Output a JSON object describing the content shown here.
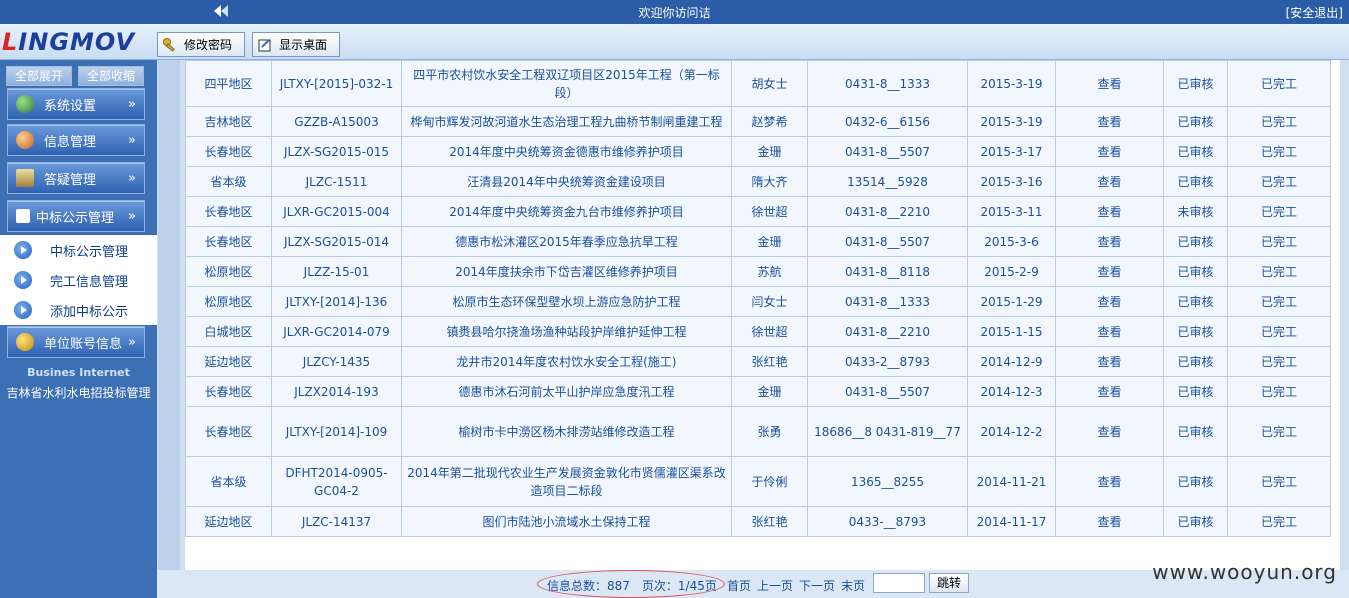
{
  "topbar": {
    "welcome": "欢迎你访问诘",
    "logout": "[安全退出]"
  },
  "logo": {
    "part1": "L",
    "part2": "INGMOV"
  },
  "header": {
    "change_password": "修改密码",
    "show_desktop": "显示桌面"
  },
  "sidebar": {
    "expand_all": "全部展开",
    "collapse_all": "全部收缩",
    "menus": [
      {
        "label": "系统设置",
        "chevron": "»"
      },
      {
        "label": "信息管理",
        "chevron": "»"
      },
      {
        "label": "答疑管理",
        "chevron": "»"
      },
      {
        "label": "中标公示管理",
        "chevron": "»"
      },
      {
        "label": "单位账号信息",
        "chevron": "»"
      }
    ],
    "subitems": [
      "中标公示管理",
      "完工信息管理",
      "添加中标公示"
    ],
    "footer_en": "Busines Internet",
    "footer_cn": "吉林省水利水电招投标管理"
  },
  "table": {
    "rows": [
      {
        "region": "四平地区",
        "code": "JLTXY-[2015]-032-1",
        "project": "四平市农村饮水安全工程双辽项目区2015年工程（第一标段）",
        "contact": "胡女士",
        "phone": "0431-8__1333",
        "date": "2015-3-19",
        "action": "查看",
        "audit": "已审核",
        "status": "已完工"
      },
      {
        "region": "吉林地区",
        "code": "GZZB-A15003",
        "project": "桦甸市辉发河故河道水生态治理工程九曲桥节制闸重建工程",
        "contact": "赵梦希",
        "phone": "0432-6__6156",
        "date": "2015-3-19",
        "action": "查看",
        "audit": "已审核",
        "status": "已完工"
      },
      {
        "region": "长春地区",
        "code": "JLZX-SG2015-015",
        "project": "2014年度中央统筹资金德惠市维修养护项目",
        "contact": "金珊",
        "phone": "0431-8__5507",
        "date": "2015-3-17",
        "action": "查看",
        "audit": "已审核",
        "status": "已完工"
      },
      {
        "region": "省本级",
        "code": "JLZC-1511",
        "project": "汪清县2014年中央统筹资金建设项目",
        "contact": "隋大齐",
        "phone": "13514__5928",
        "date": "2015-3-16",
        "action": "查看",
        "audit": "已审核",
        "status": "已完工"
      },
      {
        "region": "长春地区",
        "code": "JLXR-GC2015-004",
        "project": "2014年度中央统筹资金九台市维修养护项目",
        "contact": "徐世超",
        "phone": "0431-8__2210",
        "date": "2015-3-11",
        "action": "查看",
        "audit": "未审核",
        "status": "已完工"
      },
      {
        "region": "长春地区",
        "code": "JLZX-SG2015-014",
        "project": "德惠市松沐灌区2015年春季应急抗旱工程",
        "contact": "金珊",
        "phone": "0431-8__5507",
        "date": "2015-3-6",
        "action": "查看",
        "audit": "已审核",
        "status": "已完工"
      },
      {
        "region": "松原地区",
        "code": "JLZZ-15-01",
        "project": "2014年度扶余市下岱吉灌区维修养护项目",
        "contact": "苏航",
        "phone": "0431-8__8118",
        "date": "2015-2-9",
        "action": "查看",
        "audit": "已审核",
        "status": "已完工"
      },
      {
        "region": "松原地区",
        "code": "JLTXY-[2014]-136",
        "project": "松原市生态环保型壁水坝上游应急防护工程",
        "contact": "闫女士",
        "phone": "0431-8__1333",
        "date": "2015-1-29",
        "action": "查看",
        "audit": "已审核",
        "status": "已完工"
      },
      {
        "region": "白城地区",
        "code": "JLXR-GC2014-079",
        "project": "镇赉县哈尔挠渔场渔种站段护岸维护延伸工程",
        "contact": "徐世超",
        "phone": "0431-8__2210",
        "date": "2015-1-15",
        "action": "查看",
        "audit": "已审核",
        "status": "已完工"
      },
      {
        "region": "延边地区",
        "code": "JLZCY-1435",
        "project": "龙井市2014年度农村饮水安全工程(施工)",
        "contact": "张红艳",
        "phone": "0433-2__8793",
        "date": "2014-12-9",
        "action": "查看",
        "audit": "已审核",
        "status": "已完工"
      },
      {
        "region": "长春地区",
        "code": "JLZX2014-193",
        "project": "德惠市沐石河前太平山护岸应急度汛工程",
        "contact": "金珊",
        "phone": "0431-8__5507",
        "date": "2014-12-3",
        "action": "查看",
        "audit": "已审核",
        "status": "已完工"
      },
      {
        "region": "长春地区",
        "code": "JLTXY-[2014]-109",
        "project": "榆树市卡中澇区杨木排涝站维修改造工程",
        "contact": "张勇",
        "phone": "18686__8 0431-819__77",
        "date": "2014-12-2",
        "action": "查看",
        "audit": "已审核",
        "status": "已完工"
      },
      {
        "region": "省本级",
        "code": "DFHT2014-0905-GC04-2",
        "project": "2014年第二批现代农业生产发展资金敦化市贤儒灌区渠系改造项目二标段",
        "contact": "于伶俐",
        "phone": "1365__8255",
        "date": "2014-11-21",
        "action": "查看",
        "audit": "已审核",
        "status": "已完工"
      },
      {
        "region": "延边地区",
        "code": "JLZC-14137",
        "project": "图们市陆池小流域水土保持工程",
        "contact": "张红艳",
        "phone": "0433-__8793",
        "date": "2014-11-17",
        "action": "查看",
        "audit": "已审核",
        "status": "已完工"
      }
    ]
  },
  "pager": {
    "info": "信息总数：887　页次：1/45页",
    "first": "首页",
    "prev": "上一页",
    "next": "下一页",
    "last": "末页",
    "jump_value": "",
    "go": "跳转"
  },
  "watermark": "www.wooyun.org"
}
